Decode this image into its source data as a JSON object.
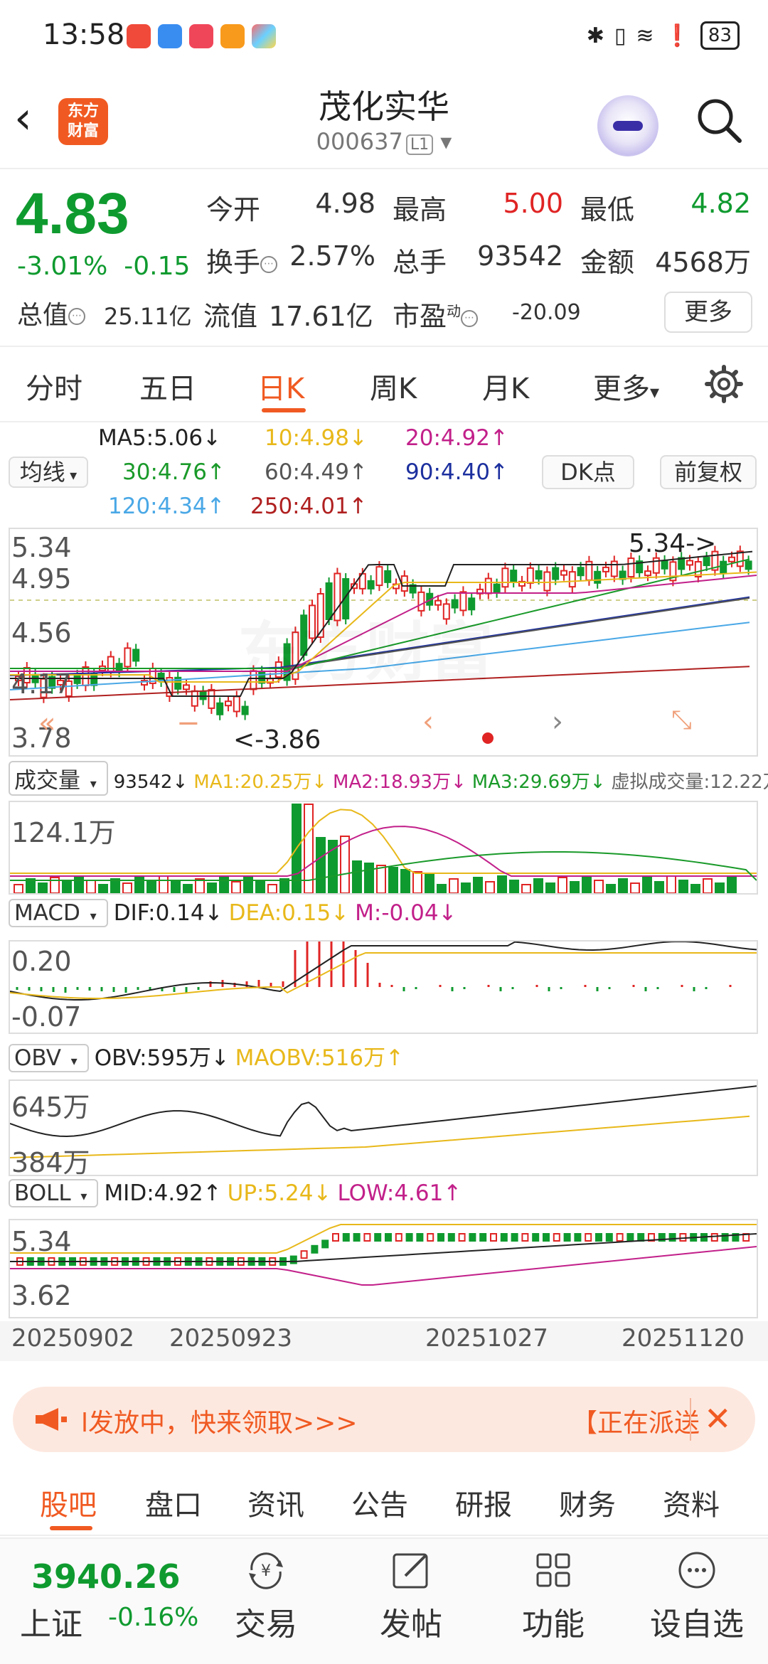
{
  "status": {
    "time": "13:58",
    "battery": "83"
  },
  "header": {
    "title": "茂化实华",
    "code": "000637",
    "level_badge": "L1",
    "brand_logo_text": "东方财富"
  },
  "quote": {
    "price": "4.83",
    "change_pct": "-3.01%",
    "change_abs": "-0.15",
    "fields": [
      {
        "label": "今开",
        "value": "4.98",
        "color": "#333333"
      },
      {
        "label": "最高",
        "value": "5.00",
        "color": "#e02424"
      },
      {
        "label": "最低",
        "value": "4.82",
        "color": "#0f9a2f"
      },
      {
        "label": "换手",
        "value": "2.57%",
        "color": "#333333"
      },
      {
        "label": "总手",
        "value": "93542",
        "color": "#333333"
      },
      {
        "label": "金额",
        "value": "4568万",
        "color": "#333333"
      }
    ],
    "total_value_label": "总值",
    "total_value": "25.11亿",
    "float_value_label": "流值",
    "float_value": "17.61亿",
    "pe_label": "市盈",
    "pe_sup": "动",
    "pe_value": "-20.09",
    "more": "更多"
  },
  "period_tabs": [
    "分时",
    "五日",
    "日K",
    "周K",
    "月K"
  ],
  "more_tab": "更多",
  "ma": {
    "selector": "均线",
    "items": [
      {
        "text": "MA5:5.06↓",
        "color": "#222222"
      },
      {
        "text": "10:4.98↓",
        "color": "#e8b81a"
      },
      {
        "text": "20:4.92↑",
        "color": "#c2208a"
      },
      {
        "text": "30:4.76↑",
        "color": "#1a9a2a"
      },
      {
        "text": "60:4.49↑",
        "color": "#555555"
      },
      {
        "text": "90:4.40↑",
        "color": "#1c2f9e"
      },
      {
        "text": "120:4.34↑",
        "color": "#4aa8e6"
      },
      {
        "text": "250:4.01↑",
        "color": "#b02020"
      }
    ],
    "dk_button": "DK点",
    "adjust_button": "前复权"
  },
  "kline": {
    "y_labels": [
      "5.34",
      "4.95",
      "4.56",
      "4.17",
      "3.78"
    ],
    "high_marker": "5.34",
    "low_marker": "3.86",
    "high_marker_arrow": "->",
    "low_marker_arrow": "<-",
    "watermark": "东方财富"
  },
  "volume": {
    "selector": "成交量",
    "value": "93542↓",
    "ma1": "MA1:20.25万↓",
    "ma2": "MA2:18.93万↓",
    "ma3": "MA3:29.69万↓",
    "virtual": "虚拟成交量:12.22万",
    "y_label": "124.1万"
  },
  "macd": {
    "selector": "MACD",
    "dif": "DIF:0.14↓",
    "dea": "DEA:0.15↓",
    "m": "M:-0.04↓",
    "y_labels": [
      "0.20",
      "-0.07"
    ]
  },
  "obv": {
    "selector": "OBV",
    "obv": "OBV:595万↓",
    "maobv": "MAOBV:516万↑",
    "y_labels": [
      "645万",
      "384万"
    ]
  },
  "boll": {
    "selector": "BOLL",
    "mid": "MID:4.92↑",
    "up": "UP:5.24↓",
    "low": "LOW:4.61↑",
    "y_labels": [
      "5.34",
      "3.62"
    ]
  },
  "dates": [
    "20250902",
    "20250923",
    "20251027",
    "20251120"
  ],
  "banner": {
    "text": "l发放中，快来领取>>>",
    "text2": "【正在派送"
  },
  "sub_tabs": [
    "股吧",
    "盘口",
    "资讯",
    "公告",
    "研报",
    "财务",
    "资料"
  ],
  "bottom": {
    "index_value": "3940.26",
    "index_name": "上证",
    "index_change": "-0.16%",
    "actions": [
      "交易",
      "发帖",
      "功能",
      "设自选"
    ]
  },
  "colors": {
    "up": "#e02424",
    "down": "#0f9a2f",
    "accent": "#f05a22"
  }
}
